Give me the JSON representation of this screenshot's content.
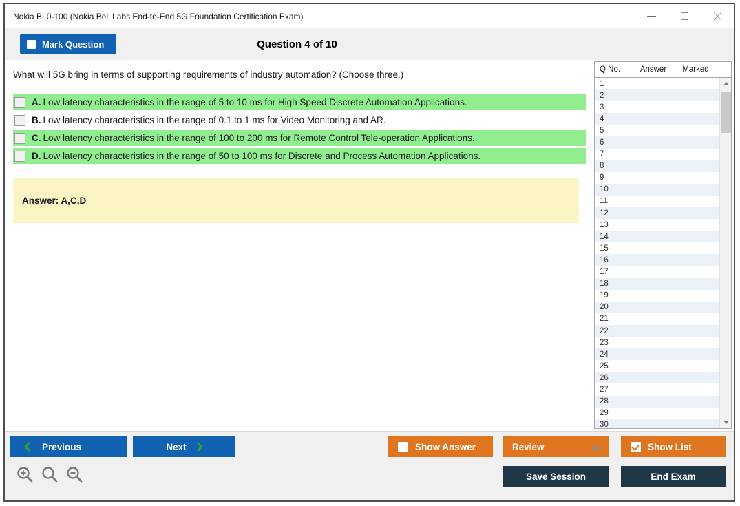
{
  "window": {
    "title": "Nokia BL0-100 (Nokia Bell Labs End-to-End 5G Foundation Certification Exam)"
  },
  "header": {
    "mark_question_label": "Mark Question",
    "question_counter": "Question 4 of 10"
  },
  "question": {
    "text": "What will 5G bring in terms of supporting requirements of industry automation? (Choose three.)",
    "options": [
      {
        "letter": "A.",
        "text": "Low latency characteristics in the range of 5 to 10 ms for High Speed Discrete Automation Applications.",
        "highlighted": true
      },
      {
        "letter": "B.",
        "text": "Low latency characteristics in the range of 0.1 to 1 ms for Video Monitoring and AR.",
        "highlighted": false
      },
      {
        "letter": "C.",
        "text": "Low latency characteristics in the range of 100 to 200 ms for Remote Control Tele-operation Applications.",
        "highlighted": true
      },
      {
        "letter": "D.",
        "text": "Low latency characteristics in the range of 50 to 100 ms for Discrete and Process Automation Applications.",
        "highlighted": true
      }
    ],
    "answer_label": "Answer: A,C,D"
  },
  "question_list": {
    "columns": [
      "Q No.",
      "Answer",
      "Marked"
    ],
    "rows": [
      "1",
      "2",
      "3",
      "4",
      "5",
      "6",
      "7",
      "8",
      "9",
      "10",
      "11",
      "12",
      "13",
      "14",
      "15",
      "16",
      "17",
      "18",
      "19",
      "20",
      "21",
      "22",
      "23",
      "24",
      "25",
      "26",
      "27",
      "28",
      "29",
      "30"
    ]
  },
  "footer": {
    "previous_label": "Previous",
    "next_label": "Next",
    "show_answer_label": "Show Answer",
    "review_label": "Review",
    "show_list_label": "Show List",
    "save_session_label": "Save Session",
    "end_exam_label": "End Exam"
  },
  "colors": {
    "accent_blue": "#1262B3",
    "accent_orange": "#E0751F",
    "accent_navy": "#1F3747",
    "highlight_green": "#90EE90",
    "answer_yellow": "#FAF3C3",
    "row_alt_blue": "#ECF1F8",
    "chevron_green": "#2FA32F"
  }
}
